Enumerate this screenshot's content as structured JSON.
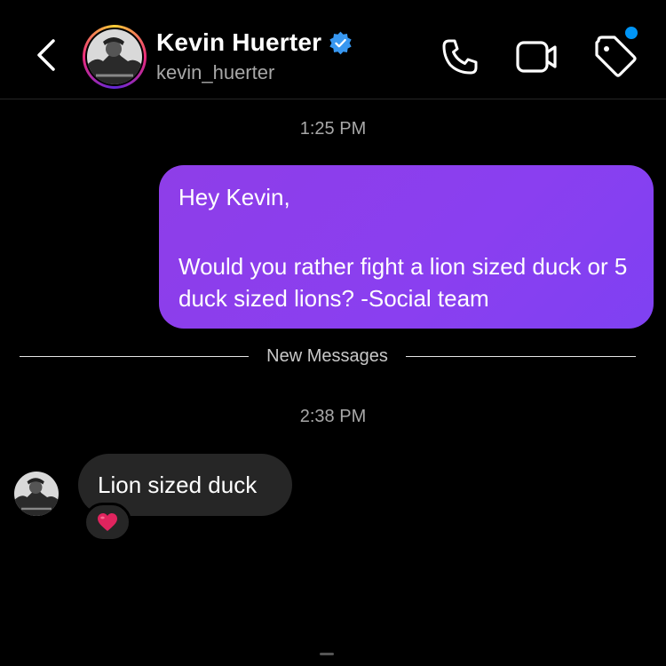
{
  "header": {
    "display_name": "Kevin Huerter",
    "username": "kevin_huerter",
    "verified": true,
    "icons": [
      "back-icon",
      "phone-icon",
      "video-camera-icon",
      "tag-icon",
      "verified-badge-icon"
    ],
    "notification_dot": true
  },
  "conversation": {
    "timestamp_1": "1:25 PM",
    "outgoing_message": {
      "line1": "Hey Kevin,",
      "line2": "Would you rather fight a lion sized duck or 5 duck sized lions?  -Social team"
    },
    "divider_label": "New Messages",
    "timestamp_2": "2:38 PM",
    "incoming_message": {
      "text": "Lion sized duck",
      "reaction": "heart"
    }
  },
  "colors": {
    "background": "#000000",
    "outgoing_bubble": "#8a3ff0",
    "incoming_bubble": "#262626",
    "secondary_text": "#a8a8a8",
    "verified_blue": "#3897f0",
    "notification_blue": "#0095f6",
    "heart_red": "#e0245e"
  }
}
